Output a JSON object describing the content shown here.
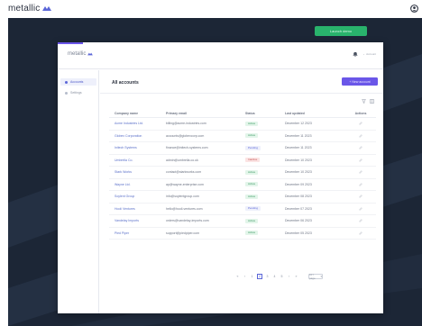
{
  "app": {
    "brand": "metallic",
    "cta_label": "Launch demo"
  },
  "window": {
    "logo": "metallic",
    "user_label": "Account",
    "sidebar": [
      {
        "label": "Accounts",
        "active": true
      },
      {
        "label": "Settings",
        "active": false
      }
    ],
    "page_title": "All accounts",
    "primary_button": "+ New account",
    "table": {
      "columns": [
        "Company name",
        "Primary email",
        "Status",
        "Last updated",
        "Actions"
      ],
      "rows": [
        {
          "name": "Acme Industries Ltd.",
          "email": "billing@acme-industries.com",
          "status": "Active",
          "updated": "December 12 2023"
        },
        {
          "name": "Globex Corporation",
          "email": "accounts@globexcorp.com",
          "status": "Active",
          "updated": "December 11 2023"
        },
        {
          "name": "Initech Systems",
          "email": "finance@initech-systems.com",
          "status": "Pending",
          "updated": "December 11 2023"
        },
        {
          "name": "Umbrella Co.",
          "email": "admin@umbrella.co.uk",
          "status": "Inactive",
          "updated": "December 10 2023"
        },
        {
          "name": "Stark Works",
          "email": "contact@starkworks.com",
          "status": "Active",
          "updated": "December 10 2023"
        },
        {
          "name": "Wayne Ltd.",
          "email": "ap@wayne-enterprise.com",
          "status": "Active",
          "updated": "December 09 2023"
        },
        {
          "name": "Soylent Group",
          "email": "info@soylentgroup.com",
          "status": "Active",
          "updated": "December 08 2023"
        },
        {
          "name": "Hooli Ventures",
          "email": "hello@hooli-ventures.com",
          "status": "Pending",
          "updated": "December 07 2023"
        },
        {
          "name": "Vandelay Imports",
          "email": "orders@vandelay-imports.com",
          "status": "Active",
          "updated": "December 06 2023"
        },
        {
          "name": "Pied Piper",
          "email": "support@piedpiper.com",
          "status": "Active",
          "updated": "December 05 2023"
        }
      ]
    },
    "pagination": {
      "pages": [
        "«",
        "‹",
        "1",
        "2",
        "3",
        "4",
        "5",
        "›",
        "»"
      ],
      "current": "2",
      "page_size": "10 / page"
    }
  },
  "colors": {
    "accent": "#6a56e8",
    "cta": "#29b36c",
    "background": "#1c2636",
    "status_active_bg": "#e3f5ea",
    "status_active_fg": "#3a9a62",
    "status_pending_bg": "#eef0fb",
    "status_pending_fg": "#5b66d8",
    "status_inactive_bg": "#fbe4e4",
    "status_inactive_fg": "#c65353"
  },
  "icons": [
    "user-circle-icon",
    "bell-icon",
    "gear-icon",
    "filter-icon",
    "columns-icon",
    "edit-icon"
  ]
}
